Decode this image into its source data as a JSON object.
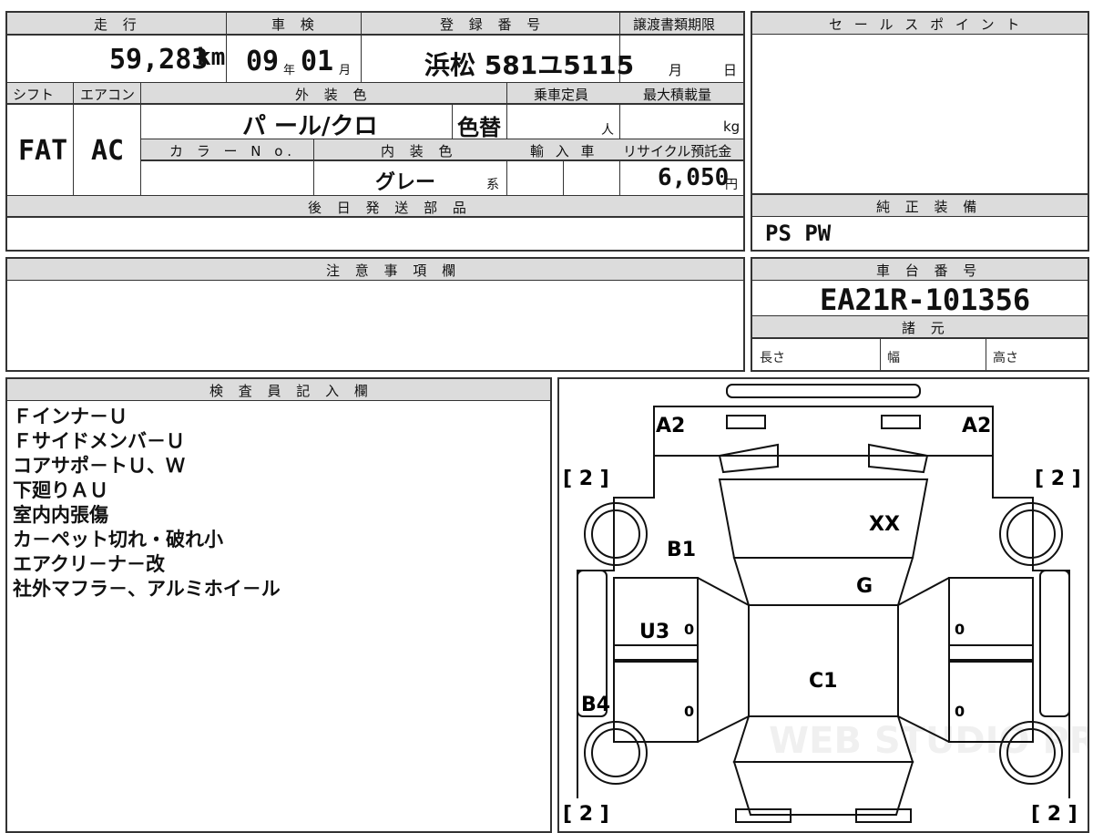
{
  "top_table": {
    "headers": {
      "mileage": "走 行",
      "inspection": "車 検",
      "registration": "登 録 番 号",
      "transfer_deadline": "譲渡書類期限",
      "shift": "シフト",
      "aircon": "エアコン",
      "exterior_color": "外 装 色",
      "capacity": "乗車定員",
      "max_load": "最大積載量",
      "color_no": "カ ラ ー N o.",
      "interior_color": "内 装 色",
      "import": "輸 入 車",
      "recycle_fee": "リサイクル預託金",
      "later_parts": "後 日 発 送 部 品"
    },
    "values": {
      "mileage": "59,283",
      "mileage_unit": "km",
      "inspection_year": "09",
      "year_unit": "年",
      "inspection_month": "01",
      "month_unit": "月",
      "registration": "浜松 581ユ5115",
      "deadline_month_unit": "月",
      "deadline_day_unit": "日",
      "shift": "FAT",
      "aircon": "AC",
      "exterior_color": "パ ール/クロ",
      "color_change": "色替",
      "capacity_unit": "人",
      "load_unit": "kg",
      "interior_color": "グレー",
      "interior_suffix": "系",
      "recycle_fee": "6,050",
      "recycle_unit": "円"
    }
  },
  "sales_point": {
    "header": "セ ー ル ス ポ イ ン ト"
  },
  "genuine_equipment": {
    "header": "純 正 装 備",
    "value": "PS  PW"
  },
  "notes": {
    "header": "注 意 事 項 欄"
  },
  "chassis": {
    "header": "車 台 番 号",
    "value": "EA21R-101356",
    "specs_header": "諸 元",
    "length": "長さ",
    "width": "幅",
    "height": "高さ"
  },
  "inspector": {
    "header": "検 査 員 記 入 欄",
    "remarks": [
      "Ｆインナ－Ｕ",
      "Ｆサイドメンバ－Ｕ",
      "コアサポ－トＵ、Ｗ",
      "下廻りＡＵ",
      "室内内張傷",
      "カ－ペット切れ・破れ小",
      "エアクリ－ナ－改",
      "社外マフラ－、アルミホイ－ル"
    ]
  },
  "diagram": {
    "marks": [
      {
        "name": "a2-left",
        "text": "A2"
      },
      {
        "name": "a2-right",
        "text": "A2"
      },
      {
        "name": "xx",
        "text": "XX"
      },
      {
        "name": "b1",
        "text": "B1"
      },
      {
        "name": "g",
        "text": "G"
      },
      {
        "name": "u3",
        "text": "U3"
      },
      {
        "name": "c1",
        "text": "C1"
      },
      {
        "name": "b4",
        "text": "B4"
      }
    ],
    "tire_labels": [
      "[ 2 ]",
      "[ 2 ]",
      "[ 2 ]",
      "[ 2 ]"
    ],
    "tread_values": [
      "0",
      "0",
      "0",
      "0"
    ],
    "watermark": "WEB STUDIO PRO"
  }
}
